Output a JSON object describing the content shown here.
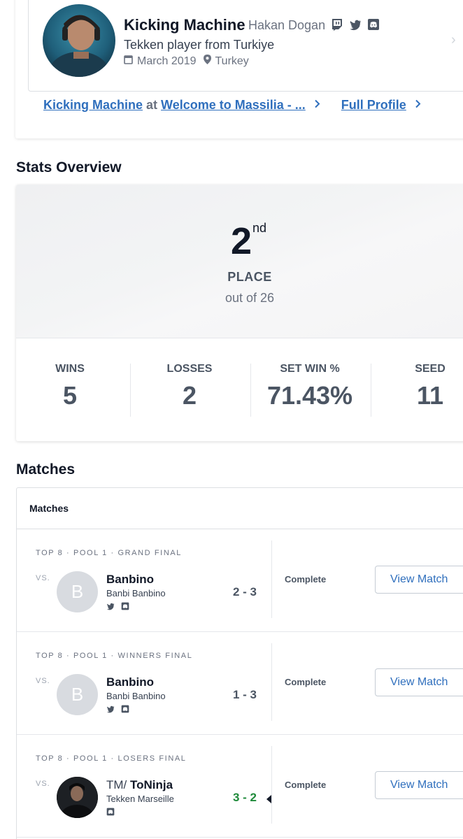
{
  "profile": {
    "gamer_tag": "Kicking Machine",
    "real_name": "Hakan Dogan",
    "bio": "Tekken player from Turkiye",
    "joined": "March 2019",
    "location": "Turkey",
    "social_icons": [
      "twitch-icon",
      "twitter-icon",
      "discord-icon"
    ]
  },
  "profile_links": {
    "event_player": "Kicking Machine",
    "at": "at",
    "event_name": "Welcome to Massilia - ...",
    "full_profile": "Full Profile"
  },
  "stats": {
    "title": "Stats Overview",
    "placement": "2",
    "placement_suffix": "nd",
    "place_label": "PLACE",
    "out_of": "out of 26",
    "items": [
      {
        "label": "WINS",
        "value": "5"
      },
      {
        "label": "LOSSES",
        "value": "2"
      },
      {
        "label": "SET WIN %",
        "value": "71.43%"
      },
      {
        "label": "SEED",
        "value": "11"
      }
    ]
  },
  "matches": {
    "title": "Matches",
    "header": "Matches",
    "vs_label": "VS.",
    "rows": [
      {
        "round": "TOP 8 · POOL 1 · GRAND FINAL",
        "opponent_initial": "B",
        "opponent_prefix": "",
        "opponent_name": "Banbino",
        "opponent_sub": "Banbi Banbino",
        "score": "2 - 3",
        "status": "Complete",
        "button": "View Match"
      },
      {
        "round": "TOP 8 · POOL 1 · WINNERS FINAL",
        "opponent_initial": "B",
        "opponent_prefix": "",
        "opponent_name": "Banbino",
        "opponent_sub": "Banbi Banbino",
        "score": "1 - 3",
        "status": "Complete",
        "button": "View Match"
      },
      {
        "round": "TOP 8 · POOL 1 · LOSERS FINAL",
        "opponent_initial": "",
        "opponent_prefix": "TM/ ",
        "opponent_name": "ToNinja",
        "opponent_sub": "Tekken Marseille",
        "score": "3 - 2",
        "status": "Complete",
        "button": "View Match"
      }
    ]
  },
  "colors": {
    "link": "#2f6fbd",
    "win_score": "#1e8a3a",
    "muted": "#4b5563"
  }
}
